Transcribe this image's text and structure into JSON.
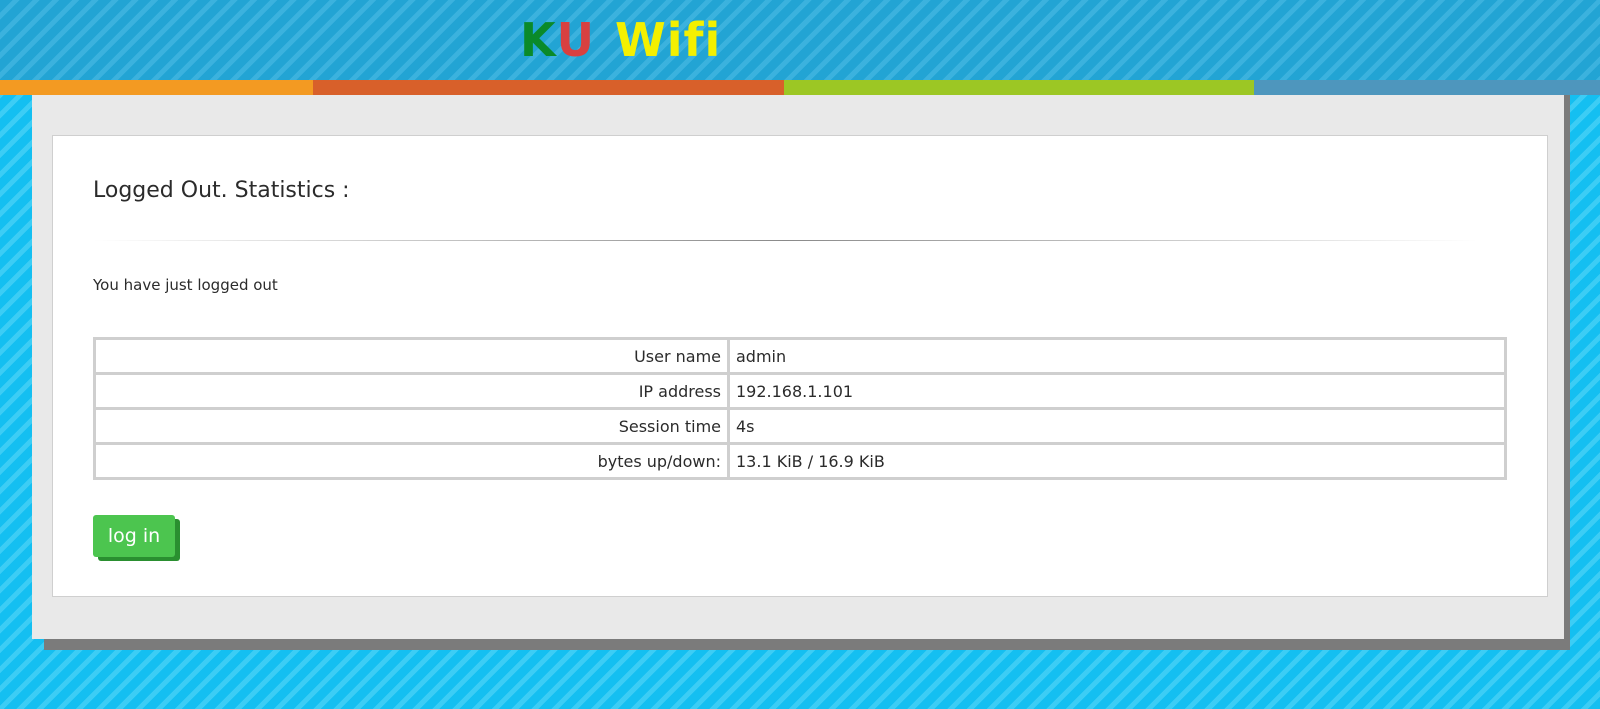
{
  "header": {
    "logo": {
      "part1": "K",
      "part2": "U",
      "part3": "Wifi"
    }
  },
  "colors": {
    "accent_bar": [
      "#f39a22",
      "#d8602a",
      "#9cc724",
      "#4e96bd"
    ],
    "logo_k": "#0a8a2a",
    "logo_u": "#d84040",
    "logo_wifi": "#f4f000",
    "button": "#4cc54f"
  },
  "main": {
    "title": "Logged Out. Statistics :",
    "message": "You have just logged out",
    "stats": [
      {
        "label": "User name",
        "value": "admin"
      },
      {
        "label": "IP address",
        "value": "192.168.1.101"
      },
      {
        "label": "Session time",
        "value": "4s"
      },
      {
        "label": "bytes up/down:",
        "value": "13.1 KiB / 16.9 KiB"
      }
    ],
    "login_button_label": "log in"
  }
}
